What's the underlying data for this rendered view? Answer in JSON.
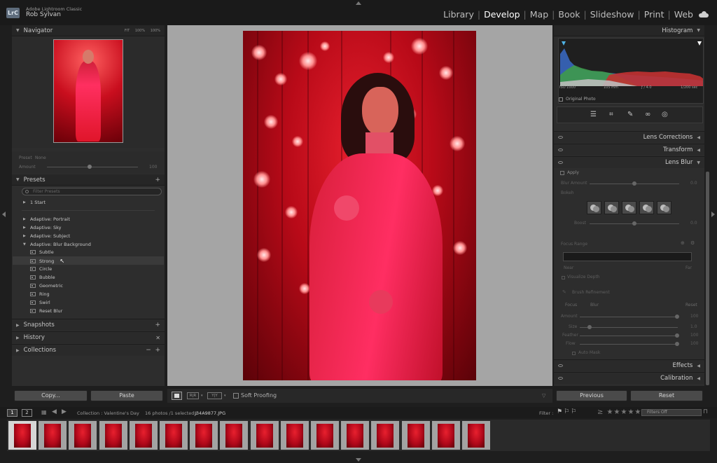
{
  "app": {
    "logo": "LrC",
    "title": "Adobe Lightroom Classic",
    "user": "Rob Sylvan"
  },
  "modules": [
    {
      "label": "Library",
      "active": false
    },
    {
      "label": "Develop",
      "active": true
    },
    {
      "label": "Map",
      "active": false
    },
    {
      "label": "Book",
      "active": false
    },
    {
      "label": "Slideshow",
      "active": false
    },
    {
      "label": "Print",
      "active": false
    },
    {
      "label": "Web",
      "active": false
    }
  ],
  "navigator": {
    "title": "Navigator",
    "zoom": [
      "FIT",
      "100%",
      "100%"
    ]
  },
  "preset_amount": {
    "preset_label": "Preset",
    "preset_value": "None",
    "amount_label": "Amount",
    "amount_value": "100"
  },
  "presets": {
    "title": "Presets",
    "filter_placeholder": "Filter Presets",
    "groups": [
      "1 Start",
      "Adaptive: Portrait",
      "Adaptive: Sky",
      "Adaptive: Subject",
      "Adaptive: Blur Background"
    ],
    "items": [
      "Subtle",
      "Strong",
      "Circle",
      "Bubble",
      "Geometric",
      "Ring",
      "Swirl",
      "Reset Blur"
    ]
  },
  "left_sections": {
    "snapshots": "Snapshots",
    "history": "History",
    "collections": "Collections"
  },
  "left_buttons": {
    "copy": "Copy...",
    "paste": "Paste"
  },
  "toolbar": {
    "soft_proofing": "Soft Proofing"
  },
  "histogram": {
    "title": "Histogram",
    "iso": "ISO 1000",
    "focal": "105 mm",
    "aperture": "ƒ / 4.0",
    "shutter": "1/200 sec",
    "original_photo": "Original Photo"
  },
  "right_sections": {
    "lens_corrections": "Lens Corrections",
    "transform": "Transform",
    "lens_blur": "Lens Blur",
    "effects": "Effects",
    "calibration": "Calibration"
  },
  "lens_blur": {
    "apply": "Apply",
    "blur_amount": "Blur Amount",
    "blur_amount_value": "0.0",
    "bokeh": "Bokeh",
    "boost": "Boost",
    "boost_value": "0.0",
    "focus_range": "Focus Range",
    "near": "Near",
    "far": "Far",
    "visualize_depth": "Visualize Depth",
    "brush_refinement": "Brush Refinement",
    "focus": "Focus",
    "blur": "Blur",
    "reset": "Reset",
    "amount": "Amount",
    "amount_value": "100",
    "size": "Size",
    "size_value": "1.0",
    "feather": "Feather",
    "feather_value": "100",
    "flow": "Flow",
    "flow_value": "100",
    "auto_mask": "Auto Mask"
  },
  "right_buttons": {
    "previous": "Previous",
    "reset": "Reset"
  },
  "filmstrip": {
    "tab1": "1",
    "tab2": "2",
    "source": "Collection : Valentine's Day",
    "count": "16 photos /1 selected /",
    "filename": "J34A9877.JPG",
    "filter_label": "Filter :",
    "filters_off": "Filters Off",
    "thumb_count": 16,
    "selected_index": 0
  },
  "colors": {
    "accent_photo": "#c80a1a",
    "panel": "#2d2d2d",
    "background": "#1e1e1e"
  }
}
